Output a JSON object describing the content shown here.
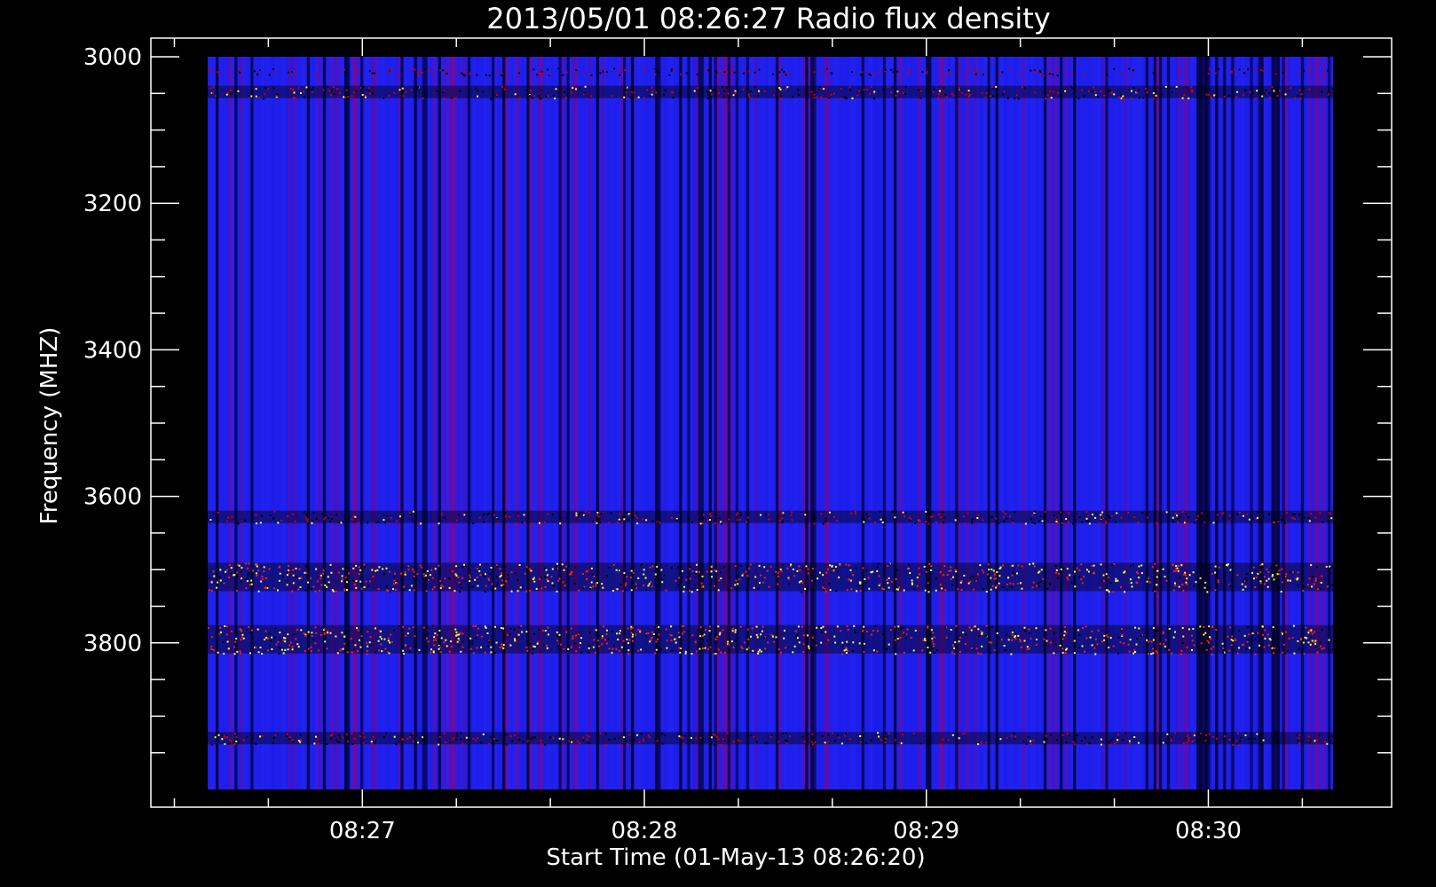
{
  "chart_data": {
    "type": "heatmap",
    "title": "2013/05/01 08:26:27 Radio flux density",
    "xlabel": "Start Time (01-May-13 08:26:20)",
    "ylabel": "Frequency (MHZ)",
    "x_tick_labels": [
      "08:27",
      "08:28",
      "08:29",
      "08:30"
    ],
    "x_tick_minutes": [
      27,
      28,
      29,
      30
    ],
    "x_range_minutes": [
      26.25,
      30.65
    ],
    "data_x_range_minutes": [
      26.45,
      30.45
    ],
    "y_tick_values": [
      3000,
      3200,
      3400,
      3600,
      3800
    ],
    "y_tick_labels": [
      "3000",
      "3200",
      "3400",
      "3600",
      "3800"
    ],
    "y_range": [
      3000,
      4000
    ],
    "y_inverted": true,
    "colormap": [
      "#000000",
      "#0000ff",
      "#ff0000",
      "#ffff00"
    ],
    "background_color": "#000000",
    "foreground_color": "#ffffff",
    "bands_mhz": [
      {
        "center": 3048,
        "intensity": "moderate"
      },
      {
        "center": 3628,
        "intensity": "moderate"
      },
      {
        "center": 3710,
        "intensity": "high"
      },
      {
        "center": 3795,
        "intensity": "high"
      },
      {
        "center": 3930,
        "intensity": "moderate"
      }
    ]
  }
}
